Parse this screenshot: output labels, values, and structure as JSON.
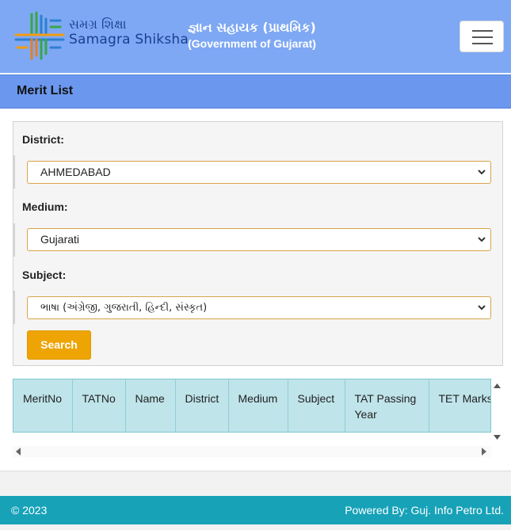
{
  "header": {
    "logo_line1": "સમગ્ર શિક્ષા",
    "logo_line2": "Samagra Shiksha",
    "title_line1": "જ્ઞાન સહાયક (પ્રાથમિક)",
    "title_line2": "(Government of Gujarat)",
    "menu_icon": "hamburger-menu-icon"
  },
  "merit_bar": {
    "label": "Merit List"
  },
  "form": {
    "district_label": "District:",
    "district_value": "AHMEDABAD",
    "medium_label": "Medium:",
    "medium_value": "Gujarati",
    "subject_label": "Subject:",
    "subject_value": "ભાષા (અંગ્રેજી, ગુજરાતી, હિન્દી, સંસ્કૃત)",
    "search_label": "Search"
  },
  "table": {
    "columns": [
      "MeritNo",
      "TATNo",
      "Name",
      "District",
      "Medium",
      "Subject",
      "TAT Passing Year",
      "TET Marks"
    ]
  },
  "footer": {
    "copyright": "© 2023",
    "powered_by": "Powered By: Guj. Info Petro Ltd."
  },
  "colors": {
    "header_bg": "#7ea8f3",
    "merit_bar_bg": "#6b98ee",
    "search_button": "#eea404",
    "table_header_bg": "#bfe4ea",
    "footer_bg": "#17a2b8"
  }
}
